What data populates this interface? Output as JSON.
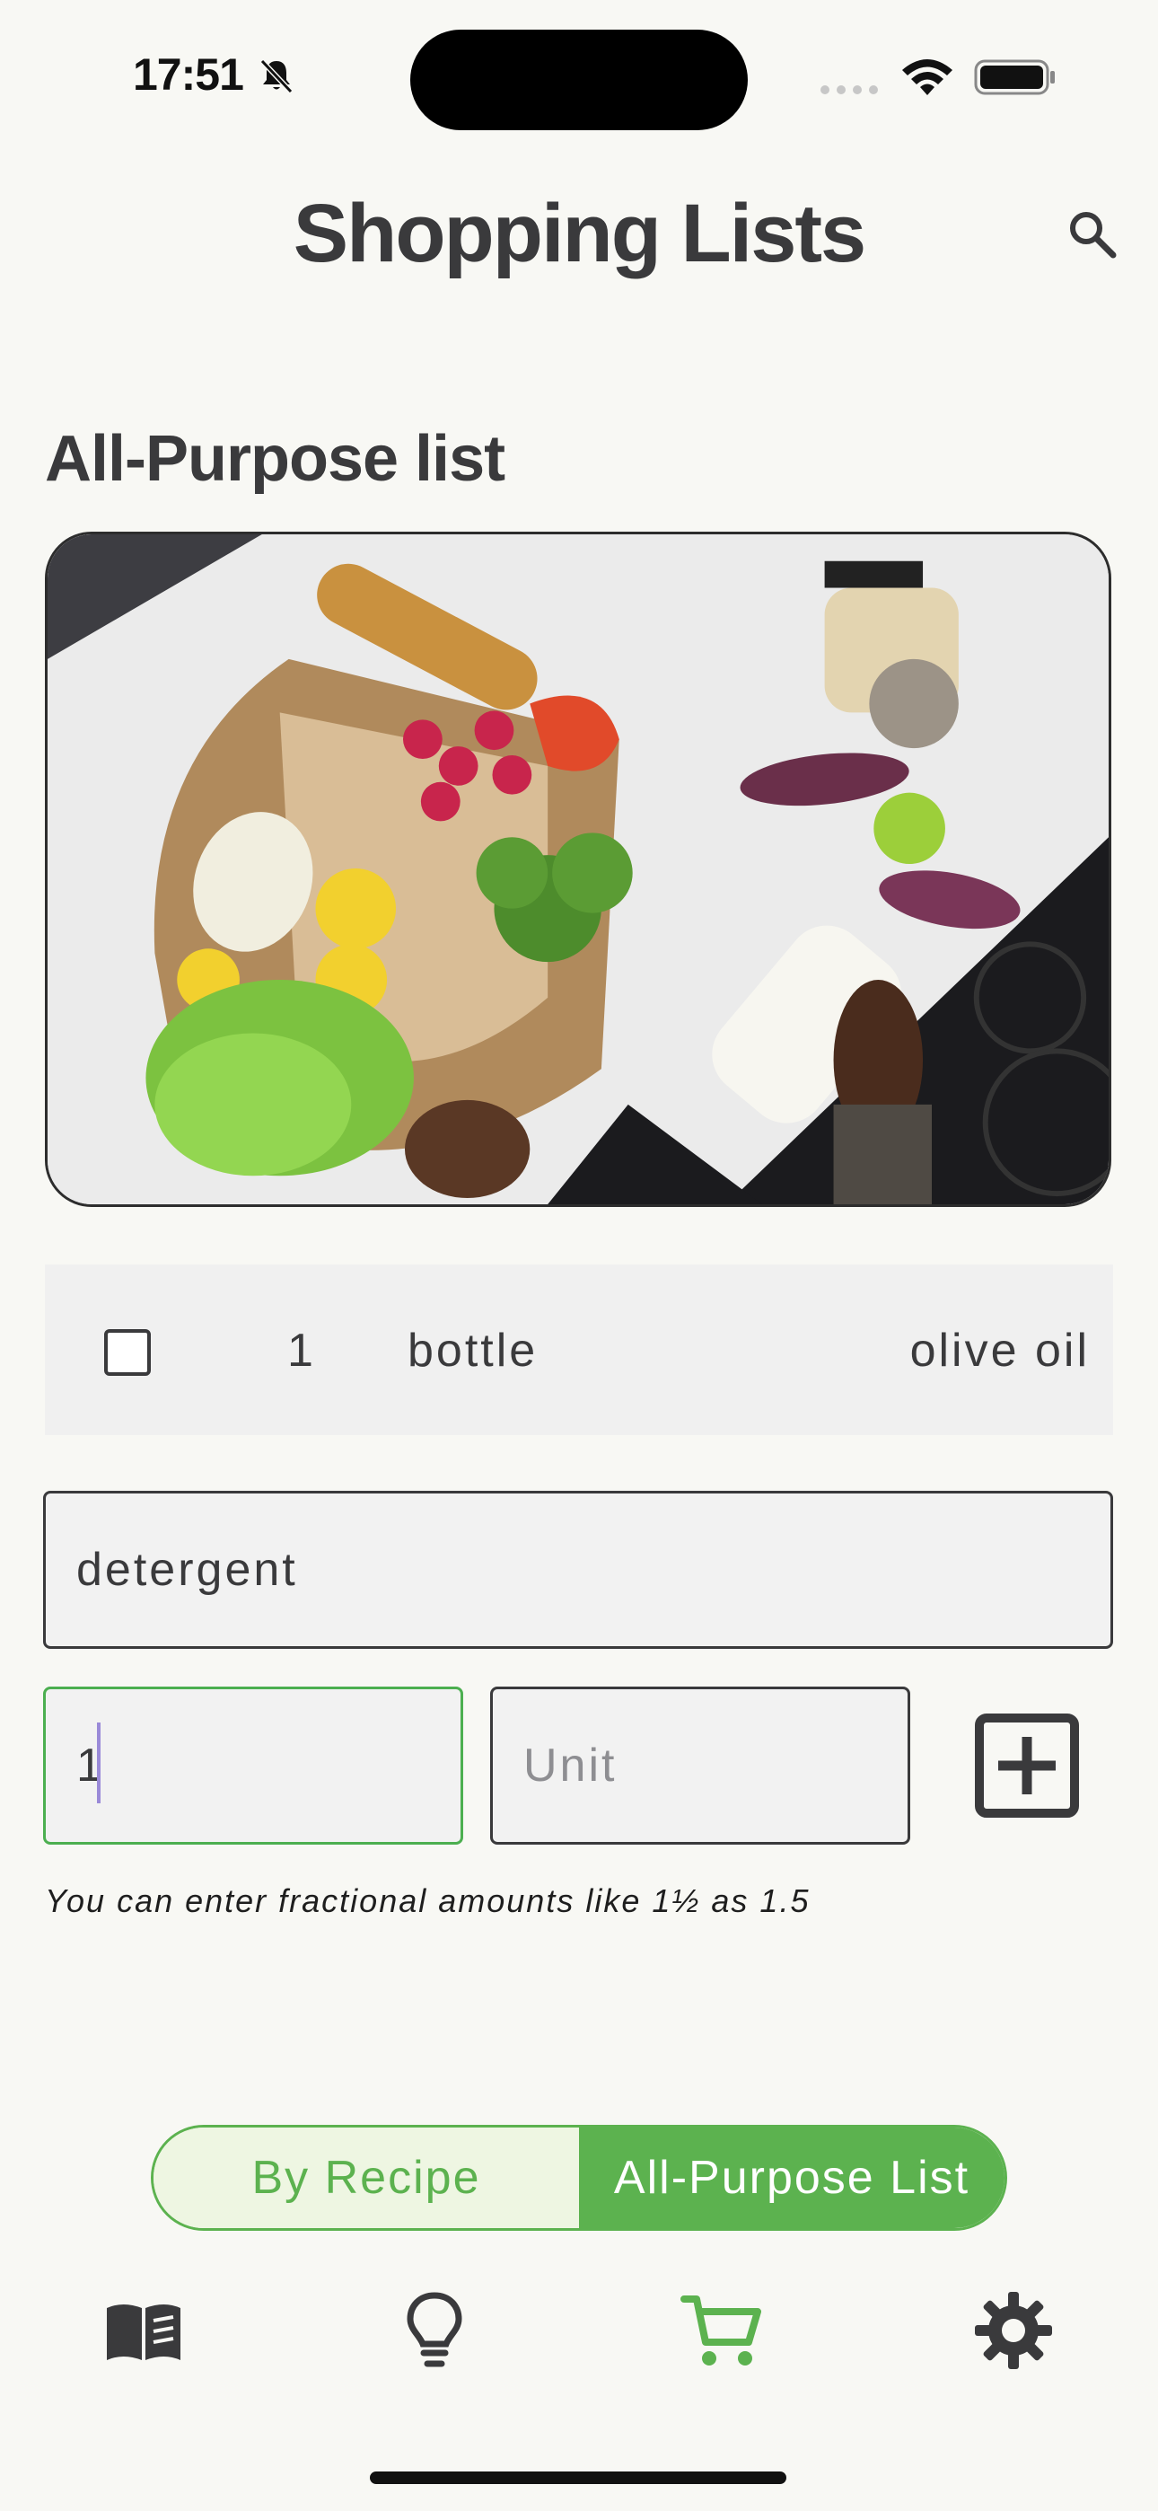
{
  "status_bar": {
    "time": "17:51"
  },
  "header": {
    "title": "Shopping Lists"
  },
  "section": {
    "title": "All-Purpose list"
  },
  "list_items": [
    {
      "checked": false,
      "quantity": "1",
      "unit": "bottle",
      "name": "olive oil"
    }
  ],
  "entry": {
    "item_value": "detergent",
    "quantity_value": "1",
    "unit_placeholder": "Unit",
    "hint": "You can enter fractional amounts like 1½ as 1.5"
  },
  "segments": {
    "by_recipe": "By Recipe",
    "all_purpose": "All-Purpose List",
    "selected": "All-Purpose List"
  },
  "tabs": [
    {
      "icon": "book-icon",
      "active": false
    },
    {
      "icon": "lightbulb-icon",
      "active": false
    },
    {
      "icon": "cart-icon",
      "active": true
    },
    {
      "icon": "gear-icon",
      "active": false
    }
  ],
  "colors": {
    "accent": "#5cb24f",
    "text": "#3a3a3c",
    "background": "#f8f8f4"
  }
}
